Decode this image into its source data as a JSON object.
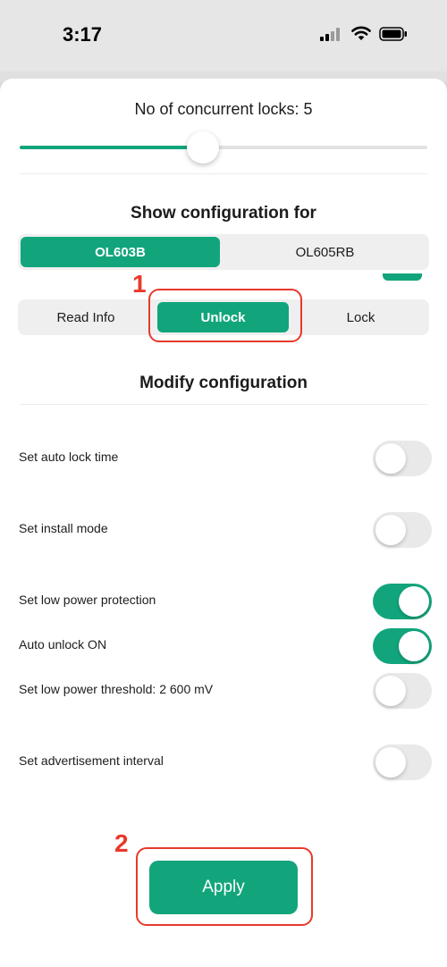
{
  "status_bar": {
    "time": "3:17"
  },
  "colors": {
    "accent": "#12a57c",
    "annotation": "#e8392b"
  },
  "concurrent_locks": {
    "label": "No of concurrent locks: 5",
    "value": 5,
    "slider_fraction": 0.45
  },
  "show_config": {
    "title": "Show configuration for",
    "models": [
      {
        "label": "OL603B",
        "selected": true
      },
      {
        "label": "OL605RB",
        "selected": false
      }
    ]
  },
  "actions": [
    {
      "label": "Read Info",
      "selected": false
    },
    {
      "label": "Unlock",
      "selected": true
    },
    {
      "label": "Lock",
      "selected": false
    }
  ],
  "modify_config": {
    "title": "Modify configuration",
    "settings": [
      {
        "label": "Set auto lock time",
        "on": false
      },
      {
        "label": "Set install mode",
        "on": false
      },
      {
        "label": "Set low power protection",
        "on": true
      },
      {
        "label": "Auto unlock ON",
        "on": true
      },
      {
        "label": "Set low power threshold: 2 600 mV",
        "on": false
      },
      {
        "label": "Set advertisement interval",
        "on": false
      }
    ]
  },
  "annotations": [
    {
      "number": "1"
    },
    {
      "number": "2"
    }
  ],
  "apply_button": {
    "label": "Apply"
  }
}
